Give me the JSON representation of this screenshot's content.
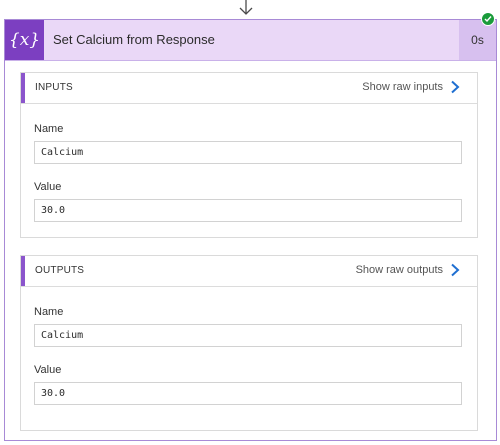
{
  "action": {
    "icon": "{x}",
    "icon_name": "variable-icon",
    "title": "Set Calcium from Response",
    "duration": "0s",
    "status": "succeeded",
    "accent_color": "#7c3fc1",
    "header_color": "#ead8f7"
  },
  "inputs": {
    "section_label": "INPUTS",
    "raw_link": "Show raw inputs",
    "name_label": "Name",
    "name_value": "Calcium",
    "value_label": "Value",
    "value_value": "30.0"
  },
  "outputs": {
    "section_label": "OUTPUTS",
    "raw_link": "Show raw outputs",
    "name_label": "Name",
    "name_value": "Calcium",
    "value_label": "Value",
    "value_value": "30.0"
  }
}
